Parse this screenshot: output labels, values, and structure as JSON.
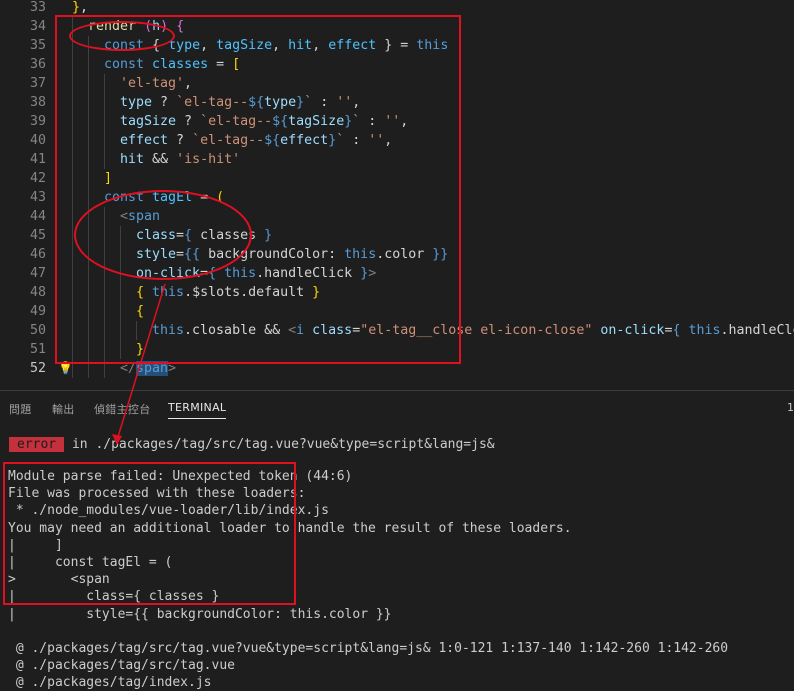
{
  "editor": {
    "lines": [
      {
        "num": "33",
        "top": "",
        "segs": [
          [
            "}",
            "y"
          ],
          [
            ",",
            "w"
          ]
        ]
      },
      {
        "num": "34",
        "segs": [
          [
            "render",
            "f"
          ],
          [
            " ",
            "w"
          ],
          [
            "(",
            "p"
          ],
          [
            "h",
            "v"
          ],
          [
            ")",
            "p"
          ],
          [
            " ",
            "w"
          ],
          [
            "{",
            "p"
          ]
        ]
      },
      {
        "num": "35",
        "segs": [
          [
            "const",
            "k"
          ],
          [
            " { ",
            "w"
          ],
          [
            "type",
            "t"
          ],
          [
            ", ",
            "w"
          ],
          [
            "tagSize",
            "t"
          ],
          [
            ", ",
            "w"
          ],
          [
            "hit",
            "t"
          ],
          [
            ", ",
            "w"
          ],
          [
            "effect",
            "t"
          ],
          [
            " } = ",
            "w"
          ],
          [
            "this",
            "k"
          ]
        ]
      },
      {
        "num": "36",
        "segs": [
          [
            "const",
            "k"
          ],
          [
            " ",
            "w"
          ],
          [
            "classes",
            "t"
          ],
          [
            " = ",
            "w"
          ],
          [
            "[",
            "y"
          ]
        ]
      },
      {
        "num": "37",
        "segs": [
          [
            "'el-tag'",
            "s"
          ],
          [
            ",",
            "w"
          ]
        ]
      },
      {
        "num": "38",
        "segs": [
          [
            "type",
            "v"
          ],
          [
            " ? ",
            "w"
          ],
          [
            "`el-tag--",
            "s"
          ],
          [
            "${",
            "k"
          ],
          [
            "type",
            "v"
          ],
          [
            "}",
            "k"
          ],
          [
            "`",
            "s"
          ],
          [
            " : ",
            "w"
          ],
          [
            "''",
            "s"
          ],
          [
            ",",
            "w"
          ]
        ]
      },
      {
        "num": "39",
        "segs": [
          [
            "tagSize",
            "v"
          ],
          [
            " ? ",
            "w"
          ],
          [
            "`el-tag--",
            "s"
          ],
          [
            "${",
            "k"
          ],
          [
            "tagSize",
            "v"
          ],
          [
            "}",
            "k"
          ],
          [
            "`",
            "s"
          ],
          [
            " : ",
            "w"
          ],
          [
            "''",
            "s"
          ],
          [
            ",",
            "w"
          ]
        ]
      },
      {
        "num": "40",
        "segs": [
          [
            "effect",
            "v"
          ],
          [
            " ? ",
            "w"
          ],
          [
            "`el-tag--",
            "s"
          ],
          [
            "${",
            "k"
          ],
          [
            "effect",
            "v"
          ],
          [
            "}",
            "k"
          ],
          [
            "`",
            "s"
          ],
          [
            " : ",
            "w"
          ],
          [
            "''",
            "s"
          ],
          [
            ",",
            "w"
          ]
        ]
      },
      {
        "num": "41",
        "segs": [
          [
            "hit",
            "v"
          ],
          [
            " && ",
            "w"
          ],
          [
            "'is-hit'",
            "s"
          ]
        ]
      },
      {
        "num": "42",
        "segs": [
          [
            "]",
            "y"
          ]
        ]
      },
      {
        "num": "43",
        "segs": [
          [
            "const",
            "k"
          ],
          [
            " ",
            "w"
          ],
          [
            "tagEl",
            "t"
          ],
          [
            " = ",
            "w"
          ],
          [
            "(",
            "y"
          ]
        ]
      },
      {
        "num": "44",
        "segs": [
          [
            "<",
            "g"
          ],
          [
            "span",
            "tg"
          ]
        ]
      },
      {
        "num": "45",
        "segs": [
          [
            "class",
            "at"
          ],
          [
            "=",
            "w"
          ],
          [
            "{",
            "k"
          ],
          [
            " classes ",
            "w"
          ],
          [
            "}",
            "k"
          ]
        ]
      },
      {
        "num": "46",
        "segs": [
          [
            "style",
            "at"
          ],
          [
            "=",
            "w"
          ],
          [
            "{{",
            "k"
          ],
          [
            " backgroundColor: ",
            "w"
          ],
          [
            "this",
            "k"
          ],
          [
            ".color ",
            "w"
          ],
          [
            "}}",
            "k"
          ]
        ]
      },
      {
        "num": "47",
        "segs": [
          [
            "on-click",
            "at"
          ],
          [
            "=",
            "w"
          ],
          [
            "{",
            "k"
          ],
          [
            " ",
            "w"
          ],
          [
            "this",
            "k"
          ],
          [
            ".handleClick ",
            "w"
          ],
          [
            "}",
            "k"
          ],
          [
            ">",
            "g"
          ]
        ]
      },
      {
        "num": "48",
        "segs": [
          [
            "{",
            "y"
          ],
          [
            " ",
            "w"
          ],
          [
            "this",
            "k"
          ],
          [
            ".$slots.default ",
            "w"
          ],
          [
            "}",
            "y"
          ]
        ]
      },
      {
        "num": "49",
        "segs": [
          [
            "{",
            "y"
          ]
        ]
      },
      {
        "num": "50",
        "segs": [
          [
            "this",
            "k"
          ],
          [
            ".closable && ",
            "w"
          ],
          [
            "<",
            "g"
          ],
          [
            "i",
            "tg"
          ],
          [
            " ",
            "w"
          ],
          [
            "class",
            "at"
          ],
          [
            "=",
            "w"
          ],
          [
            "\"el-tag__close el-icon-close\"",
            "s"
          ],
          [
            " ",
            "w"
          ],
          [
            "on-click",
            "at"
          ],
          [
            "=",
            "w"
          ],
          [
            "{",
            "k"
          ],
          [
            " ",
            "w"
          ],
          [
            "this",
            "k"
          ],
          [
            ".handleClose ",
            "w"
          ],
          [
            "}",
            "k"
          ],
          [
            ">",
            "g"
          ]
        ]
      },
      {
        "num": "51",
        "segs": [
          [
            "}",
            "y"
          ]
        ]
      },
      {
        "num": "52",
        "segs": [
          [
            "</",
            "g"
          ],
          [
            "span",
            "tg"
          ],
          [
            ">",
            "g"
          ]
        ]
      }
    ]
  },
  "panel": {
    "tabs": [
      "問題",
      "輸出",
      "偵錯主控台",
      "TERMINAL"
    ],
    "right_indicator": "1",
    "error_badge": "error",
    "error_location": " in ./packages/tag/src/tag.vue?vue&type=script&lang=js&",
    "output_lines": [
      "Module parse failed: Unexpected token (44:6)",
      "File was processed with these loaders:",
      " * ./node_modules/vue-loader/lib/index.js",
      "You may need an additional loader to handle the result of these loaders.",
      "|     ]",
      "|     const tagEl = (",
      ">       <span",
      "|         class={ classes }",
      "|         style={{ backgroundColor: this.color }}"
    ],
    "trace_lines": [
      " @ ./packages/tag/src/tag.vue?vue&type=script&lang=js& 1:0-121 1:137-140 1:142-260 1:142-260",
      " @ ./packages/tag/src/tag.vue",
      " @ ./packages/tag/index.js"
    ]
  },
  "colors": {
    "annotation": "#e01020",
    "error_badge": "#c4303b",
    "keyword": "#569cd6",
    "string": "#ce9178"
  }
}
